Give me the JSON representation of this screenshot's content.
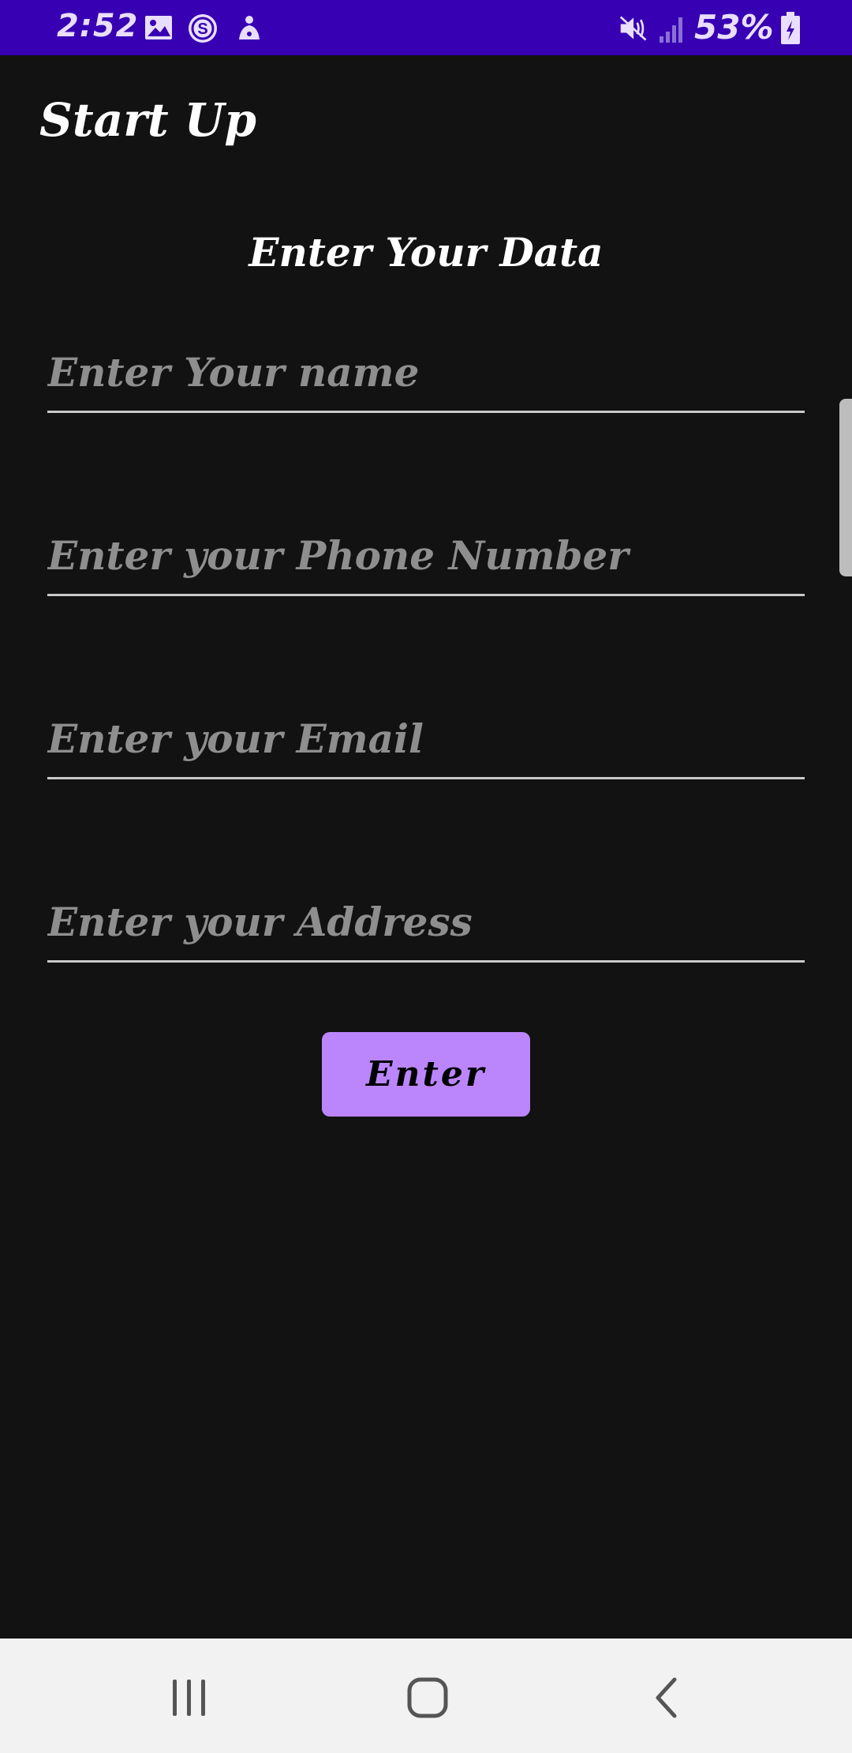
{
  "status_bar": {
    "time": "2:52",
    "battery_percent": "53%",
    "icons": [
      "image-icon",
      "s-app-icon",
      "notification-icon",
      "mute-icon",
      "signal-icon",
      "battery-icon"
    ],
    "background_color": "#3700b3"
  },
  "app_bar": {
    "title": "Start Up"
  },
  "form": {
    "heading": "Enter Your Data",
    "fields": [
      {
        "name": "name",
        "placeholder": "Enter Your name",
        "value": ""
      },
      {
        "name": "phone",
        "placeholder": "Enter your Phone Number",
        "value": ""
      },
      {
        "name": "email",
        "placeholder": "Enter your Email",
        "value": ""
      },
      {
        "name": "address",
        "placeholder": "Enter your Address",
        "value": ""
      }
    ],
    "submit_label": "Enter",
    "accent_color": "#bb86fc"
  },
  "nav_bar": {
    "buttons": [
      "recent-apps-icon",
      "home-icon",
      "back-icon"
    ]
  }
}
